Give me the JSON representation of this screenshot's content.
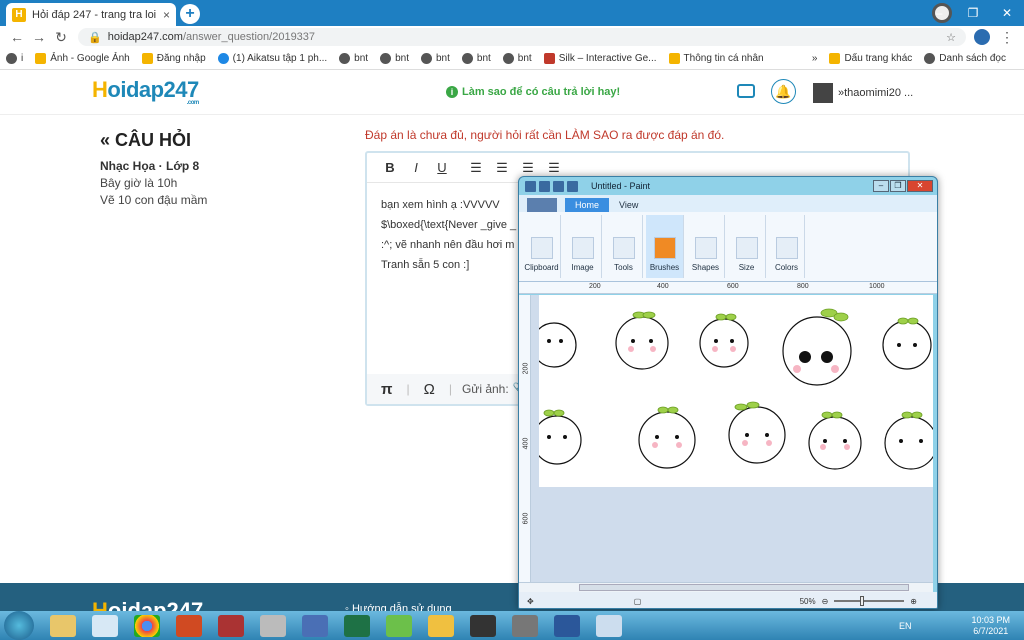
{
  "browser": {
    "tab_title": "Hỏi đáp 247 - trang tra loi",
    "tab_favicon": "H",
    "tab_close": "×",
    "new_tab": "+",
    "url_host": "hoidap247.com",
    "url_path": "/answer_question/2019337",
    "window_controls": [
      "–",
      "❐",
      "✕"
    ],
    "bookmarks": [
      {
        "label": "i",
        "icon": "globe"
      },
      {
        "label": "Ảnh - Google Ảnh",
        "icon": "pinwheel"
      },
      {
        "label": "Đăng nhập",
        "icon": "smiley"
      },
      {
        "label": "(1) Aikatsu tập 1 ph...",
        "icon": "triangle"
      },
      {
        "label": "bnt",
        "icon": "globe"
      },
      {
        "label": "bnt",
        "icon": "globe"
      },
      {
        "label": "bnt",
        "icon": "globe"
      },
      {
        "label": "bnt",
        "icon": "globe"
      },
      {
        "label": "bnt",
        "icon": "globe"
      },
      {
        "label": "Silk – Interactive Ge...",
        "icon": "silk"
      },
      {
        "label": "Thông tin cá nhân",
        "icon": "hoidap"
      }
    ],
    "bookmarks_more": "»",
    "bookmarks_other": "Dấu trang khác",
    "bookmarks_list": "Danh sách đọc"
  },
  "site": {
    "logo_h": "H",
    "logo_rest": "oidap247",
    "logo_com": ".com",
    "help_text": "Làm sao để có câu trả lời hay!",
    "username": "thaomimi20 ..."
  },
  "question": {
    "header": "« CÂU HỎI",
    "subject": "Nhạc Họa · Lớp 8",
    "lines": [
      "Bây giờ là 10h",
      "Vẽ 10 con đậu mầm"
    ]
  },
  "answer": {
    "warning": "Đáp án là chưa đủ, người hỏi rất cần LÀM SAO ra được đáp án đó.",
    "toolbar": [
      "B",
      "I",
      "U"
    ],
    "body_lines": [
      "bạn xem hình ạ :VVVVV",
      "$\\boxed{\\text{Never _give _",
      ":^; vẽ nhanh nên đầu hơi m",
      "Tranh sẵn 5 con :]"
    ],
    "footer_pi": "π",
    "footer_omega": "Ω",
    "footer_upload": "Gửi ảnh:"
  },
  "footer": {
    "logo_h": "H",
    "logo_rest": "oidap247",
    "link": "◦ Hướng dẫn sử dụng"
  },
  "paint": {
    "title": "Untitled - Paint",
    "tabs": [
      "Home",
      "View"
    ],
    "groups": [
      "Clipboard",
      "Image",
      "Tools",
      "Brushes",
      "Shapes",
      "Size",
      "Colors"
    ],
    "ruler_h": [
      "200",
      "400",
      "600",
      "800",
      "1000"
    ],
    "ruler_v": [
      "200",
      "400",
      "600"
    ],
    "zoom": "50%"
  },
  "taskbar": {
    "lang": "EN",
    "time": "10:03 PM",
    "date": "6/7/2021"
  }
}
